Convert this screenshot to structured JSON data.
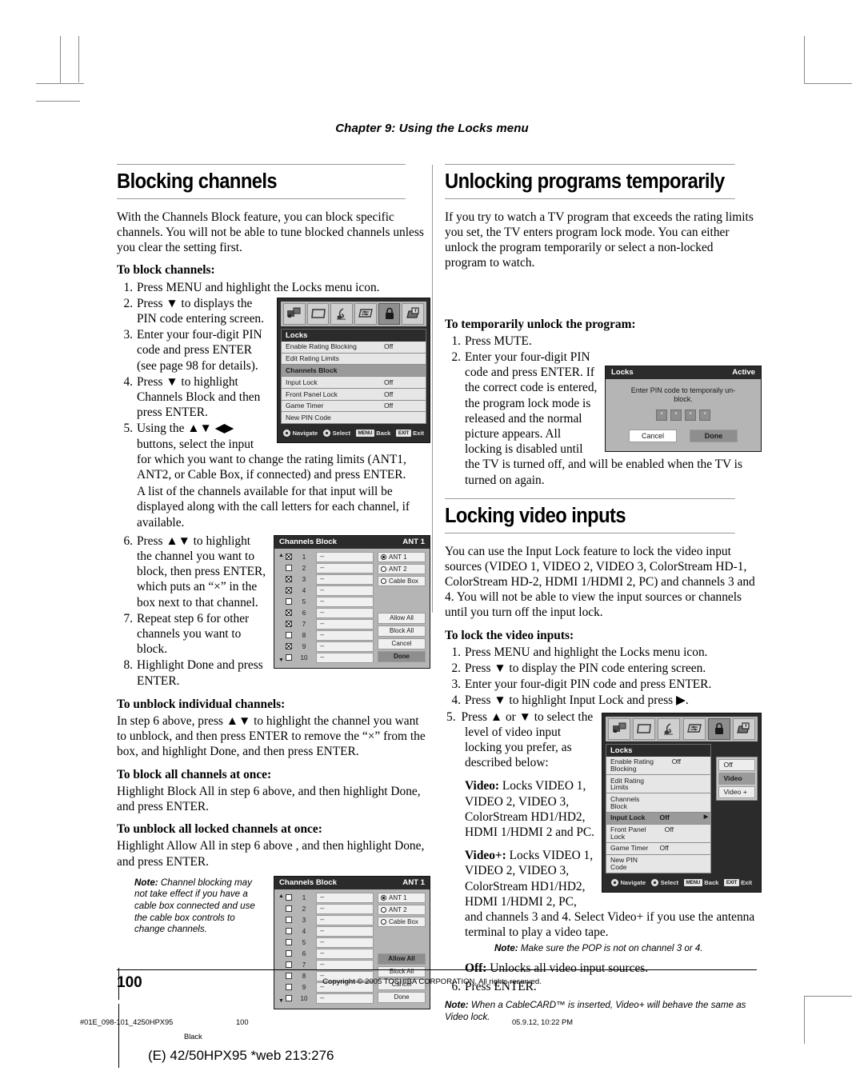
{
  "chapter_header": "Chapter 9: Using the Locks menu",
  "left_column": {
    "heading": "Blocking channels",
    "intro": "With the Channels Block feature, you can block specific channels. You will not be able to tune blocked channels unless you clear the setting first.",
    "sub1": "To block channels:",
    "steps": [
      {
        "num": "1.",
        "text": "Press MENU and highlight the Locks menu icon."
      },
      {
        "num": "2.",
        "text": "Press ▼ to displays the PIN code entering screen."
      },
      {
        "num": "3.",
        "text": "Enter your four-digit PIN code and press ENTER (see page 98 for details)."
      },
      {
        "num": "4.",
        "text": "Press ▼ to highlight Channels Block and then press ENTER."
      },
      {
        "num": "5.",
        "text": "Using the ▲▼ ◀▶ buttons, select the input for which you want to change the rating limits (ANT1, ANT2, or Cable Box, if connected) and press ENTER."
      }
    ],
    "step5_note": "A list of the channels available for that input will be displayed along with the call letters for each channel, if available.",
    "steps2": [
      {
        "num": "6.",
        "text": "Press ▲▼ to highlight the channel you want to block, then press ENTER, which puts an “×” in the box next to that channel."
      },
      {
        "num": "7.",
        "text": "Repeat step 6 for other channels you want to block."
      },
      {
        "num": "8.",
        "text": "Highlight Done and press ENTER."
      }
    ],
    "sub2": "To unblock individual channels:",
    "para2": "In step 6 above, press ▲▼ to highlight the channel you want to unblock, and then press ENTER to remove the “×” from the box, and highlight Done, and then press ENTER.",
    "sub3": "To block all channels at once:",
    "para3": "Highlight Block All in step 6 above, and then highlight Done, and press ENTER.",
    "sub4": "To unblock all locked channels at once:",
    "para4": "Highlight Allow All in step 6 above , and then highlight Done, and press ENTER.",
    "note_label": "Note:",
    "note_text": "Channel blocking may not take effect if you have a cable box connected and use the cable box controls to change channels."
  },
  "right_column": {
    "heading1": "Unlocking programs temporarily",
    "intro1": "If you try to watch a TV program that exceeds the rating limits you set, the TV enters program lock mode. You can either unlock the program temporarily or select a non-locked program to watch.",
    "sub1": "To temporarily unlock the program:",
    "steps": [
      {
        "num": "1.",
        "text": "Press MUTE."
      },
      {
        "num": "2.",
        "text": "Enter your four-digit PIN code and press ENTER. If the correct code is entered, the program lock mode is released and the normal picture appears. All locking is disabled until the TV is turned off, and will be enabled when the TV is turned on again."
      }
    ],
    "heading2": "Locking video inputs",
    "intro2": "You can use the Input Lock feature to lock the video input sources (VIDEO 1, VIDEO 2, VIDEO 3, ColorStream HD-1, ColorStream HD-2, HDMI 1/HDMI 2, PC) and channels 3 and 4. You will not be able to view the input sources or channels until you turn off the input lock.",
    "sub2": "To lock the video inputs:",
    "steps2": [
      {
        "num": "1.",
        "text": "Press MENU and highlight the Locks menu icon."
      },
      {
        "num": "2.",
        "text": "Press ▼ to display the PIN code entering screen."
      },
      {
        "num": "3.",
        "text": "Enter your four-digit PIN code and press ENTER."
      },
      {
        "num": "4.",
        "text": "Press ▼ to highlight Input Lock and press ▶."
      },
      {
        "num": "5.",
        "text": "Press ▲ or ▼ to select the level of video input locking you prefer, as described below:"
      }
    ],
    "def_video_label": "Video:",
    "def_video_text": " Locks VIDEO 1, VIDEO 2, VIDEO 3, ColorStream HD1/HD2, HDMI 1/HDMI 2 and PC.",
    "def_videoplus_label": "Video+:",
    "def_videoplus_text": " Locks VIDEO 1, VIDEO 2, VIDEO 3, ColorStream HD1/HD2, HDMI 1/HDMI 2, PC, and channels 3 and 4. Select Video+ if you use the antenna terminal to play a video tape.",
    "note_pop_label": "Note:",
    "note_pop_text": "Make sure the POP is not on channel 3 or 4.",
    "def_off_label": "Off:",
    "def_off_text": " Unlocks all video input sources.",
    "step6": {
      "num": "6.",
      "text": "Press ENTER."
    },
    "note2_label": "Note:",
    "note2_text": "When a CableCARD™ is inserted, Video+ will behave the same as Video lock."
  },
  "osd_locks_menu_1": {
    "title": "Locks",
    "rows": [
      {
        "label": "Enable Rating Blocking",
        "value": "Off",
        "highlight": false
      },
      {
        "label": "Edit Rating Limits",
        "value": "",
        "highlight": false
      },
      {
        "label": "Channels Block",
        "value": "",
        "highlight": true
      },
      {
        "label": "Input Lock",
        "value": "Off",
        "highlight": false
      },
      {
        "label": "Front Panel Lock",
        "value": "Off",
        "highlight": false
      },
      {
        "label": "Game Timer",
        "value": "Off",
        "highlight": false
      },
      {
        "label": "New PIN Code",
        "value": "",
        "highlight": false
      }
    ],
    "nav": {
      "navigate": "Navigate",
      "select": "Select",
      "back_key": "MENU",
      "back": "Back",
      "exit_key": "EXIT",
      "exit": "Exit"
    },
    "icons": [
      "picture-icon",
      "screen-icon",
      "audio-icon",
      "settings-icon",
      "locks-icon",
      "setup-icon"
    ]
  },
  "osd_locks_menu_2": {
    "title": "Locks",
    "rows": [
      {
        "label": "Enable Rating Blocking",
        "value": "Off",
        "highlight": false,
        "arrow": ""
      },
      {
        "label": "Edit Rating Limits",
        "value": "",
        "highlight": false,
        "arrow": ""
      },
      {
        "label": "Channels Block",
        "value": "",
        "highlight": false,
        "arrow": ""
      },
      {
        "label": "Input Lock",
        "value": "Off",
        "highlight": true,
        "arrow": "▶"
      },
      {
        "label": "Front Panel Lock",
        "value": "Off",
        "highlight": false,
        "arrow": ""
      },
      {
        "label": "Game Timer",
        "value": "Off",
        "highlight": false,
        "arrow": ""
      },
      {
        "label": "New PIN Code",
        "value": "",
        "highlight": false,
        "arrow": ""
      }
    ],
    "submenu": [
      {
        "label": "Off",
        "highlight": false
      },
      {
        "label": "Video",
        "highlight": true
      },
      {
        "label": "Video +",
        "highlight": false
      }
    ],
    "nav": {
      "navigate": "Navigate",
      "select": "Select",
      "back_key": "MENU",
      "back": "Back",
      "exit_key": "EXIT",
      "exit": "Exit"
    }
  },
  "channels_block_1": {
    "title": "Channels Block",
    "input": "ANT 1",
    "channels": [
      {
        "num": "1",
        "call": "--",
        "checked": true
      },
      {
        "num": "2",
        "call": "--",
        "checked": false
      },
      {
        "num": "3",
        "call": "--",
        "checked": true
      },
      {
        "num": "4",
        "call": "--",
        "checked": true
      },
      {
        "num": "5",
        "call": "--",
        "checked": false
      },
      {
        "num": "6",
        "call": "--",
        "checked": true
      },
      {
        "num": "7",
        "call": "--",
        "checked": true
      },
      {
        "num": "8",
        "call": "--",
        "checked": false
      },
      {
        "num": "9",
        "call": "--",
        "checked": true
      },
      {
        "num": "10",
        "call": "--",
        "checked": false
      }
    ],
    "sources": [
      {
        "label": "ANT 1",
        "selected": true
      },
      {
        "label": "ANT 2",
        "selected": false
      },
      {
        "label": "Cable Box",
        "selected": false
      }
    ],
    "buttons": [
      {
        "label": "Allow All",
        "highlight": false
      },
      {
        "label": "Block All",
        "highlight": false
      },
      {
        "label": "Cancel",
        "highlight": false
      },
      {
        "label": "Done",
        "highlight": true
      }
    ]
  },
  "channels_block_2": {
    "title": "Channels Block",
    "input": "ANT 1",
    "channels": [
      {
        "num": "1",
        "call": "--",
        "checked": false
      },
      {
        "num": "2",
        "call": "--",
        "checked": false
      },
      {
        "num": "3",
        "call": "--",
        "checked": false
      },
      {
        "num": "4",
        "call": "--",
        "checked": false
      },
      {
        "num": "5",
        "call": "--",
        "checked": false
      },
      {
        "num": "6",
        "call": "--",
        "checked": false
      },
      {
        "num": "7",
        "call": "--",
        "checked": false
      },
      {
        "num": "8",
        "call": "--",
        "checked": false
      },
      {
        "num": "9",
        "call": "--",
        "checked": false
      },
      {
        "num": "10",
        "call": "--",
        "checked": false
      }
    ],
    "sources": [
      {
        "label": "ANT 1",
        "selected": true
      },
      {
        "label": "ANT 2",
        "selected": false
      },
      {
        "label": "Cable Box",
        "selected": false
      }
    ],
    "buttons": [
      {
        "label": "Allow All",
        "highlight": true
      },
      {
        "label": "Block All",
        "highlight": false
      },
      {
        "label": "Cancel",
        "highlight": false
      },
      {
        "label": "Done",
        "highlight": false
      }
    ]
  },
  "pin_dialog": {
    "title": "Locks",
    "status": "Active",
    "message": "Enter PIN code to temporaily un-block.",
    "digits": [
      "*",
      "*",
      "*",
      "*"
    ],
    "cancel": "Cancel",
    "done": "Done"
  },
  "footer": {
    "page_number": "100",
    "copyright": "Copyright © 2005 TOSHIBA CORPORATION. All rights reserved.",
    "print_file": "#01E_098-101_4250HPX95",
    "print_page": "100",
    "print_date": "05.9.12, 10:22 PM",
    "print_black": "Black",
    "print_web": "(E) 42/50HPX95 *web 213:276"
  }
}
